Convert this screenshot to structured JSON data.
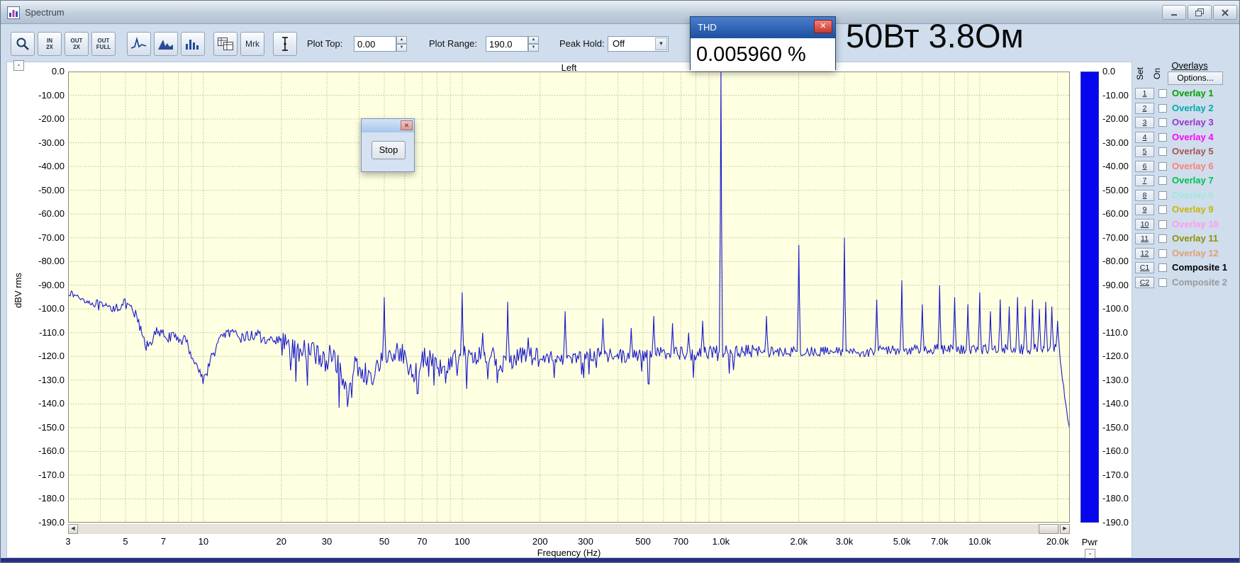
{
  "window": {
    "title": "Spectrum"
  },
  "toolbar": {
    "zoom_buttons": [
      {
        "name": "zoom-in-2x-button",
        "line1": "IN",
        "line2": "2X"
      },
      {
        "name": "zoom-out-2x-button",
        "line1": "OUT",
        "line2": "2X"
      },
      {
        "name": "zoom-out-full-button",
        "line1": "OUT",
        "line2": "FULL"
      }
    ],
    "mrk_label": "Mrk",
    "plot_top_label": "Plot Top:",
    "plot_top_value": "0.00",
    "plot_range_label": "Plot Range:",
    "plot_range_value": "190.0",
    "peak_hold_label": "Peak Hold:",
    "peak_hold_value": "Off"
  },
  "thd_window": {
    "title": "THD",
    "value": "0.005960 %"
  },
  "annotation": "50Вт 3.8Ом",
  "stop_dialog": {
    "stop_label": "Stop"
  },
  "plot": {
    "channel_label": "Left",
    "ylabel": "dBV rms",
    "xlabel": "Frequency (Hz)",
    "pwr_label": "Pwr",
    "collapse_glyph": "-",
    "y_tick_labels": [
      "0.0",
      "-10.00",
      "-20.00",
      "-30.00",
      "-40.00",
      "-50.00",
      "-60.00",
      "-70.00",
      "-80.00",
      "-90.00",
      "-100.0",
      "-110.0",
      "-120.0",
      "-130.0",
      "-140.0",
      "-150.0",
      "-160.0",
      "-170.0",
      "-180.0",
      "-190.0"
    ]
  },
  "overlays": {
    "title": "Overlays",
    "set_label": "Set",
    "on_label": "On",
    "options_label": "Options...",
    "items": [
      {
        "num": "1",
        "label": "Overlay 1",
        "color": "#00a000",
        "checked": false
      },
      {
        "num": "2",
        "label": "Overlay 2",
        "color": "#00aaaa",
        "checked": false
      },
      {
        "num": "3",
        "label": "Overlay 3",
        "color": "#9933cc",
        "checked": false
      },
      {
        "num": "4",
        "label": "Overlay 4",
        "color": "#ff00ff",
        "checked": false
      },
      {
        "num": "5",
        "label": "Overlay 5",
        "color": "#a65353",
        "checked": false
      },
      {
        "num": "6",
        "label": "Overlay 6",
        "color": "#ff8070",
        "checked": false
      },
      {
        "num": "7",
        "label": "Overlay 7",
        "color": "#00c050",
        "checked": false
      },
      {
        "num": "8",
        "label": "Overlay 8",
        "color": "#a0e8e0",
        "checked": false
      },
      {
        "num": "9",
        "label": "Overlay 9",
        "color": "#c8b400",
        "checked": false
      },
      {
        "num": "10",
        "label": "Overlay 10",
        "color": "#ff9aee",
        "checked": false
      },
      {
        "num": "11",
        "label": "Overlay 11",
        "color": "#909000",
        "checked": false
      },
      {
        "num": "12",
        "label": "Overlay 12",
        "color": "#e0a070",
        "checked": false
      },
      {
        "num": "C1",
        "label": "Composite 1",
        "color": "#000000",
        "checked": false
      },
      {
        "num": "C2",
        "label": "Composite 2",
        "color": "#999999",
        "checked": false
      }
    ]
  },
  "chart_data": {
    "type": "line",
    "title": "Spectrum analyzer, Left channel",
    "xlabel": "Frequency (Hz)",
    "ylabel": "dBV rms",
    "x_scale": "log",
    "x_range_hz": [
      3,
      22300
    ],
    "y_range_db": [
      -190,
      0
    ],
    "y_grid_step_db": 10,
    "x_tick_labels": [
      "3",
      "5",
      "7",
      "10",
      "20",
      "30",
      "50",
      "70",
      "100",
      "200",
      "300",
      "500",
      "700",
      "1.0k",
      "2.0k",
      "3.0k",
      "5.0k",
      "7.0k",
      "10.0k",
      "20.0k"
    ],
    "x_tick_freqs": [
      3,
      5,
      7,
      10,
      20,
      30,
      50,
      70,
      100,
      200,
      300,
      500,
      700,
      1000,
      2000,
      3000,
      5000,
      7000,
      10000,
      20000
    ],
    "grid_freqs": [
      3,
      4,
      5,
      6,
      7,
      8,
      9,
      10,
      20,
      30,
      40,
      50,
      60,
      70,
      80,
      90,
      100,
      200,
      300,
      400,
      500,
      600,
      700,
      800,
      900,
      1000,
      2000,
      3000,
      4000,
      5000,
      6000,
      7000,
      8000,
      9000,
      10000,
      20000
    ],
    "trace_color": "#1a1acd",
    "thd_percent": 0.00596,
    "fundamental_hz": 1000,
    "noise_floor_points": [
      [
        3,
        -93
      ],
      [
        3.6,
        -97
      ],
      [
        4.2,
        -100
      ],
      [
        5,
        -98
      ],
      [
        5.5,
        -103
      ],
      [
        6,
        -116
      ],
      [
        6.6,
        -110
      ],
      [
        7.5,
        -112
      ],
      [
        8.5,
        -113
      ],
      [
        10,
        -130
      ],
      [
        11,
        -118
      ],
      [
        12,
        -110
      ],
      [
        14,
        -112
      ],
      [
        16,
        -111
      ],
      [
        18,
        -113
      ],
      [
        20,
        -114
      ],
      [
        23,
        -119
      ],
      [
        26,
        -117
      ],
      [
        29,
        -122
      ],
      [
        32,
        -119
      ],
      [
        36,
        -137
      ],
      [
        39,
        -123
      ],
      [
        42,
        -126
      ],
      [
        44,
        -132
      ],
      [
        47,
        -121
      ],
      [
        52,
        -120
      ],
      [
        58,
        -118
      ],
      [
        65,
        -129
      ],
      [
        72,
        -120
      ],
      [
        80,
        -123
      ],
      [
        86,
        -128
      ],
      [
        95,
        -119
      ],
      [
        110,
        -121
      ],
      [
        125,
        -119
      ],
      [
        140,
        -123
      ],
      [
        165,
        -120
      ],
      [
        200,
        -120
      ],
      [
        260,
        -121
      ],
      [
        330,
        -119
      ],
      [
        430,
        -120
      ],
      [
        560,
        -119
      ],
      [
        720,
        -119
      ],
      [
        950,
        -118
      ],
      [
        1300,
        -118
      ],
      [
        1800,
        -118
      ],
      [
        2600,
        -118
      ],
      [
        3600,
        -118
      ],
      [
        5200,
        -117
      ],
      [
        7500,
        -117
      ],
      [
        11000,
        -117
      ],
      [
        16000,
        -117
      ],
      [
        20000,
        -116
      ],
      [
        20600,
        -124
      ],
      [
        21200,
        -135
      ],
      [
        21900,
        -146
      ],
      [
        22300,
        -150
      ]
    ],
    "peaks": [
      [
        50,
        -95
      ],
      [
        100,
        -93
      ],
      [
        120,
        -110
      ],
      [
        150,
        -97
      ],
      [
        180,
        -112
      ],
      [
        250,
        -101
      ],
      [
        350,
        -104
      ],
      [
        450,
        -108
      ],
      [
        550,
        -103
      ],
      [
        650,
        -106
      ],
      [
        750,
        -110
      ],
      [
        850,
        -105
      ],
      [
        1000,
        0
      ],
      [
        1500,
        -103
      ],
      [
        2000,
        -73
      ],
      [
        3000,
        -70
      ],
      [
        4000,
        -96
      ],
      [
        5000,
        -88
      ],
      [
        6000,
        -98
      ],
      [
        7000,
        -90
      ],
      [
        8000,
        -95
      ],
      [
        9000,
        -98
      ],
      [
        10000,
        -93
      ],
      [
        11000,
        -101
      ],
      [
        12000,
        -96
      ],
      [
        13000,
        -99
      ],
      [
        14000,
        -95
      ],
      [
        15000,
        -99
      ],
      [
        16000,
        -96
      ],
      [
        17000,
        -100
      ],
      [
        18000,
        -97
      ],
      [
        19000,
        -99
      ],
      [
        20000,
        -105
      ]
    ]
  }
}
